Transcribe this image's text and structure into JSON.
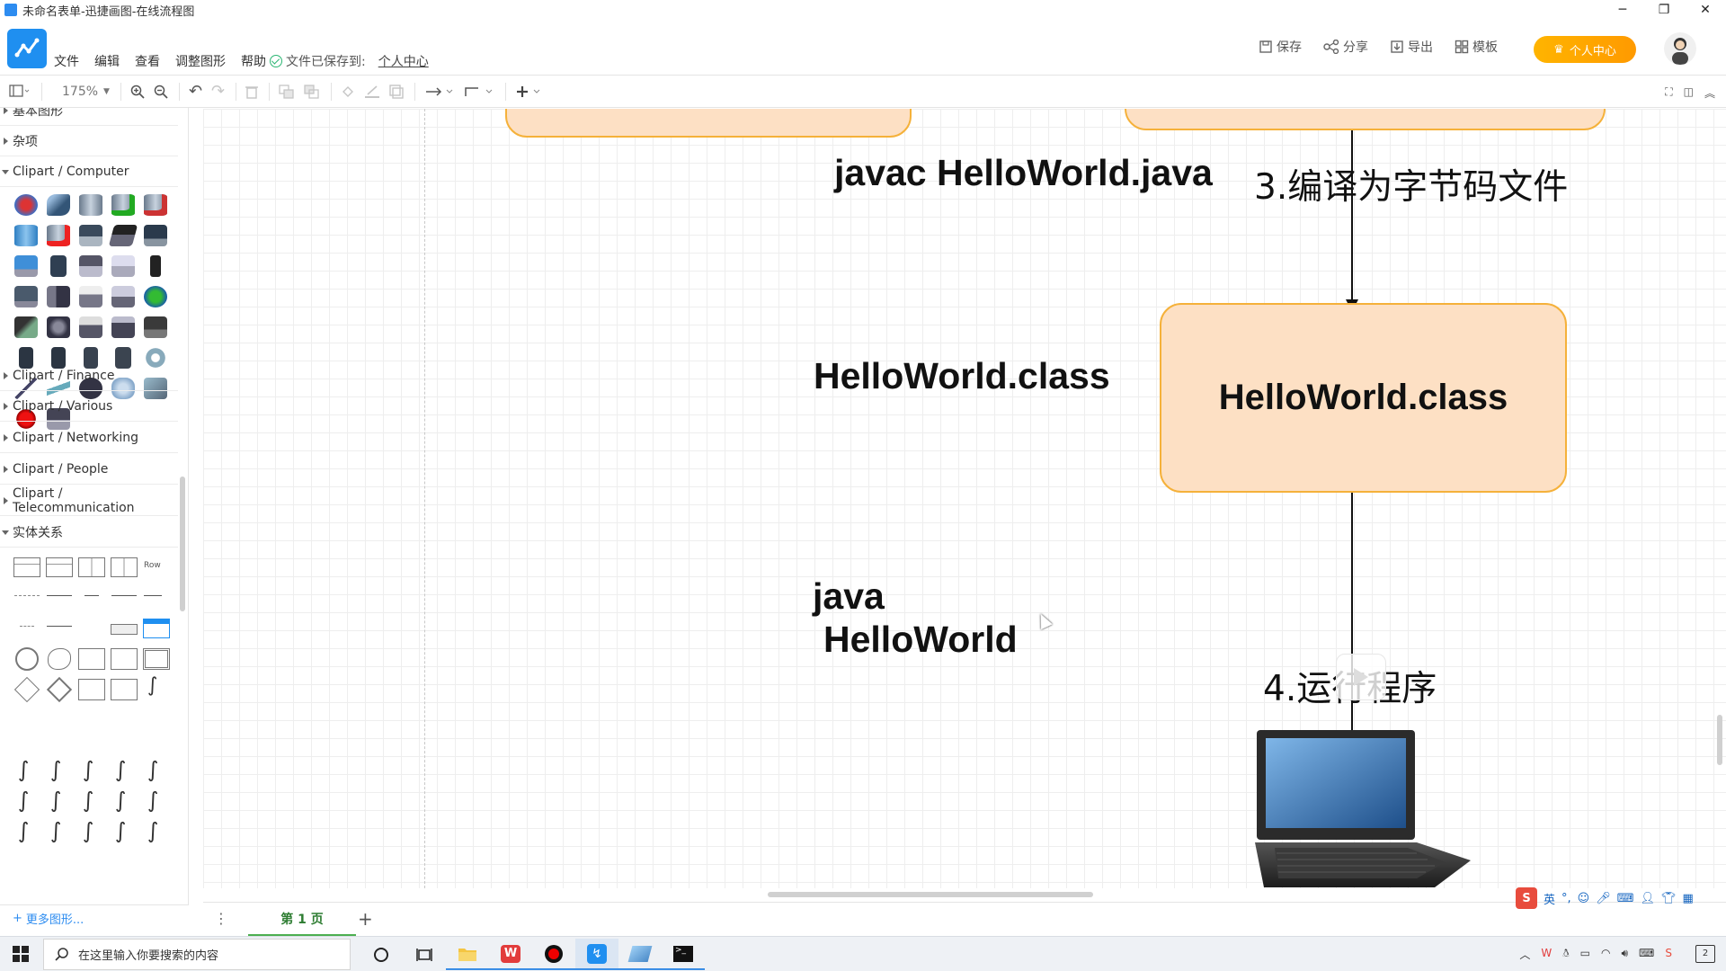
{
  "window": {
    "title": "未命名表单-迅捷画图-在线流程图",
    "minimize": "─",
    "restore": "❐",
    "close": "✕"
  },
  "header": {
    "menu": [
      "文件",
      "编辑",
      "查看",
      "调整图形",
      "帮助"
    ],
    "save_status": "文件已保存到:",
    "save_location": "个人中心",
    "actions": [
      {
        "icon": "save-icon",
        "label": "保存"
      },
      {
        "icon": "share-icon",
        "label": "分享"
      },
      {
        "icon": "export-icon",
        "label": "导出"
      },
      {
        "icon": "template-icon",
        "label": "模板"
      }
    ],
    "vip_label": "个人中心"
  },
  "toolbar": {
    "zoom": "175%"
  },
  "sidebar": {
    "sections": [
      {
        "label": "基本图形",
        "open": false
      },
      {
        "label": "杂项",
        "open": false
      },
      {
        "label": "Clipart / Computer",
        "open": true
      },
      {
        "label": "Clipart / Finance",
        "open": false
      },
      {
        "label": "Clipart / Various",
        "open": false
      },
      {
        "label": "Clipart / Networking",
        "open": false
      },
      {
        "label": "Clipart / People",
        "open": false
      },
      {
        "label": "Clipart / Telecommunication",
        "open": false
      },
      {
        "label": "实体关系",
        "open": true
      }
    ],
    "er_row_label": "Row",
    "more_shapes": "更多图形..."
  },
  "canvas": {
    "step3_command": "javac HelloWorld.java",
    "step3_title": "3.编译为字节码文件",
    "class_label": "HelloWorld.class",
    "class_node": "HelloWorld.class",
    "run_command_line1": "java",
    "run_command_line2": "HelloWorld",
    "step4_title": "4.运行程序"
  },
  "pagebar": {
    "page_tab": "第 1 页",
    "add": "+"
  },
  "ime": {
    "lang": "英"
  },
  "taskbar": {
    "search_placeholder": "在这里输入你要搜索的内容",
    "notification_count": "2"
  },
  "colors": {
    "node_fill": "#fde0c4",
    "node_border": "#f5b13a",
    "accent": "#1f8ff0",
    "vip": "#ffa800"
  }
}
